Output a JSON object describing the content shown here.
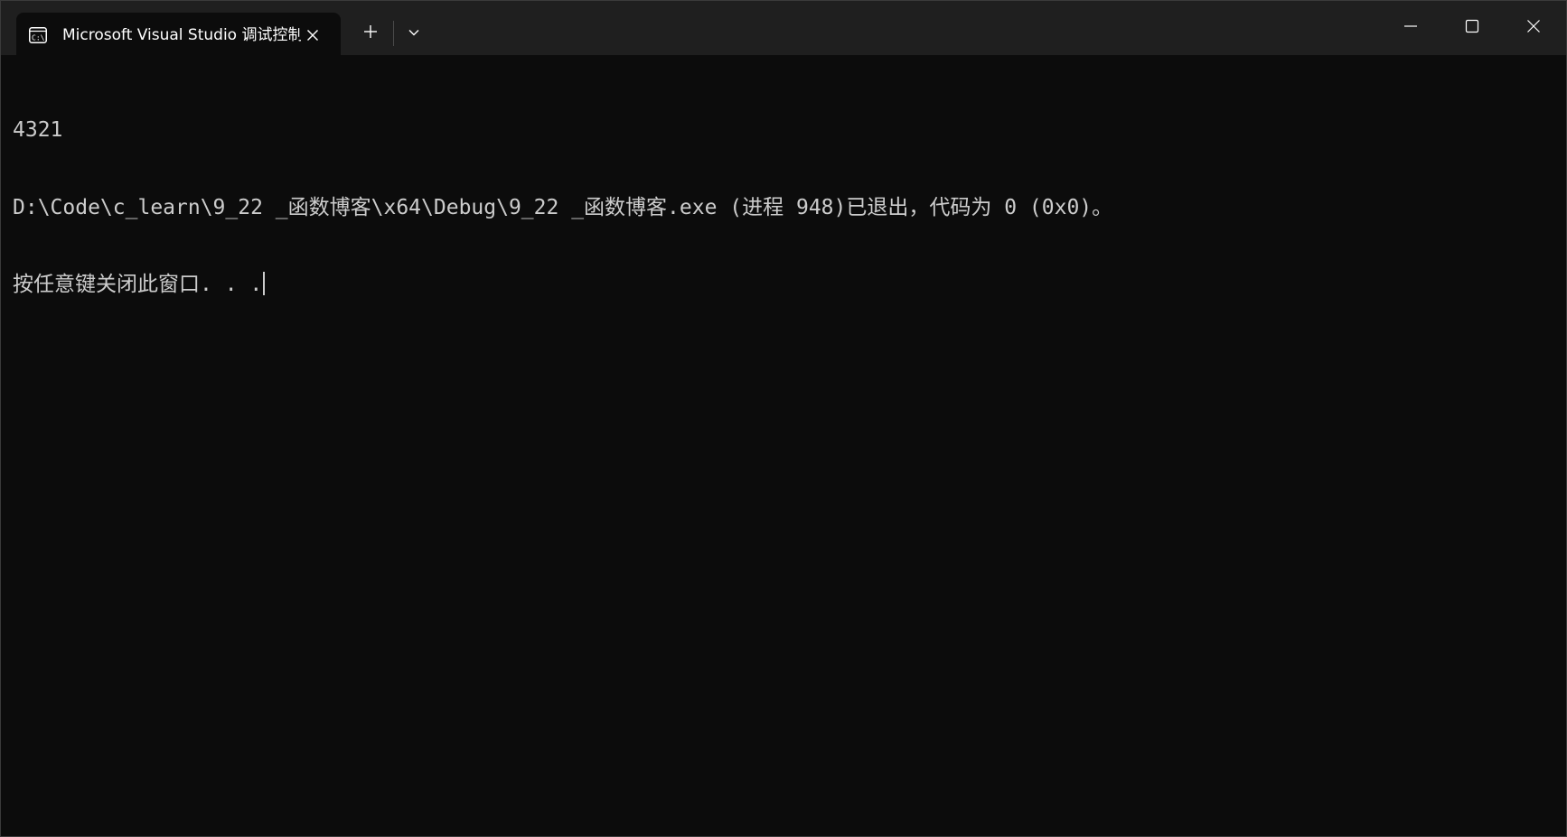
{
  "window": {
    "background": "#0c0c0c",
    "titlebar_color": "#1f1f1f"
  },
  "tab": {
    "icon": "console-icon",
    "title": "Microsoft Visual Studio 调试控制台",
    "close_icon": "close-icon"
  },
  "titlebar": {
    "new_tab_icon": "plus-icon",
    "dropdown_icon": "chevron-down-icon",
    "minimize_icon": "minimize-icon",
    "maximize_icon": "maximize-icon",
    "close_icon": "close-icon"
  },
  "console": {
    "text_color": "#cccccc",
    "lines": [
      "4321",
      "D:\\Code\\c_learn\\9_22 _函数博客\\x64\\Debug\\9_22 _函数博客.exe (进程 948)已退出，代码为 0 (0x0)。",
      "按任意键关闭此窗口. . ."
    ]
  }
}
